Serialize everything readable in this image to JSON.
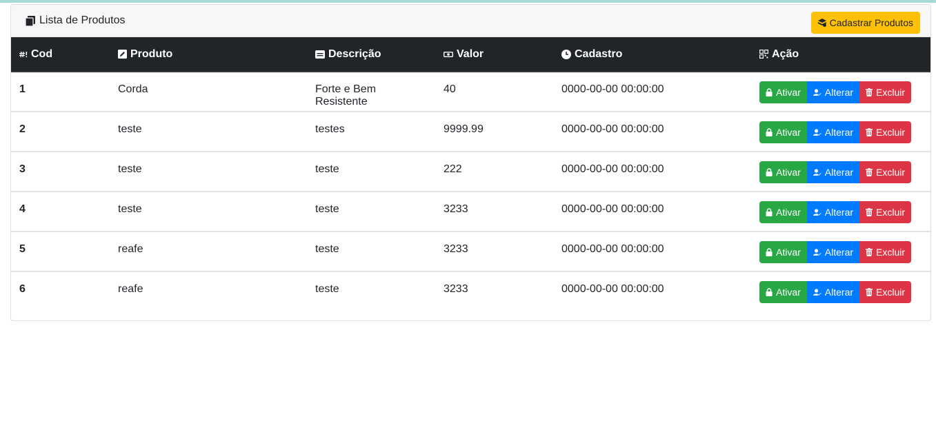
{
  "header": {
    "title": "Lista de Produtos",
    "title_icon": "clipboard-list-icon",
    "add_button_label": "Cadastrar Produtos",
    "add_button_icon": "box-add-icon"
  },
  "table": {
    "columns": [
      {
        "label": "Cod",
        "icon": "hash-icon"
      },
      {
        "label": "Produto",
        "icon": "edit-square-icon"
      },
      {
        "label": "Descrição",
        "icon": "card-text-icon"
      },
      {
        "label": "Valor",
        "icon": "money-icon"
      },
      {
        "label": "Cadastro",
        "icon": "clock-icon"
      },
      {
        "label": "Ação",
        "icon": "grid-icon"
      }
    ],
    "rows": [
      {
        "cod": "1",
        "produto": "Corda",
        "descricao": "Forte e Bem Resistente",
        "valor": "40",
        "cadastro": "0000-00-00 00:00:00"
      },
      {
        "cod": "2",
        "produto": "teste",
        "descricao": "testes",
        "valor": "9999.99",
        "cadastro": "0000-00-00 00:00:00"
      },
      {
        "cod": "3",
        "produto": "teste",
        "descricao": "teste",
        "valor": "222",
        "cadastro": "0000-00-00 00:00:00"
      },
      {
        "cod": "4",
        "produto": "teste",
        "descricao": "teste",
        "valor": "3233",
        "cadastro": "0000-00-00 00:00:00"
      },
      {
        "cod": "5",
        "produto": "reafe",
        "descricao": "teste",
        "valor": "3233",
        "cadastro": "0000-00-00 00:00:00"
      },
      {
        "cod": "6",
        "produto": "reafe",
        "descricao": "teste",
        "valor": "3233",
        "cadastro": "0000-00-00 00:00:00"
      }
    ],
    "actions": {
      "activate_label": "Ativar",
      "edit_label": "Alterar",
      "delete_label": "Excluir"
    }
  },
  "colors": {
    "header_bg": "#212529",
    "success": "#28a745",
    "primary": "#007bff",
    "danger": "#dc3545",
    "warning": "#ffc107"
  }
}
